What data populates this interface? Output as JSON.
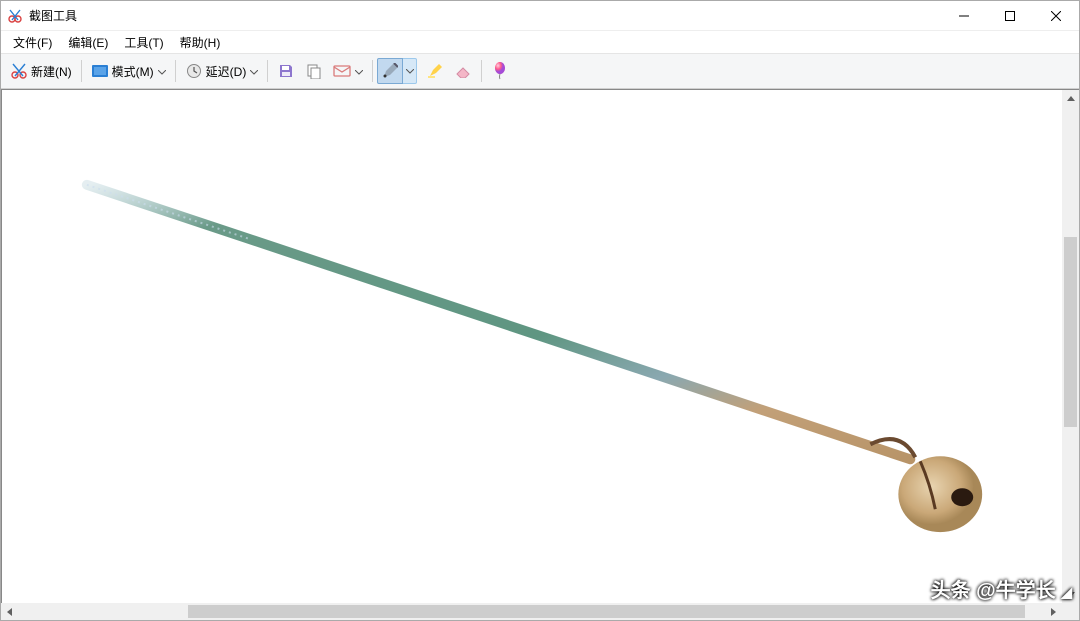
{
  "titlebar": {
    "title": "截图工具"
  },
  "menu": {
    "file": "文件(F)",
    "edit": "编辑(E)",
    "tools": "工具(T)",
    "help": "帮助(H)"
  },
  "toolbar": {
    "new_label": "新建(N)",
    "mode_label": "模式(M)",
    "delay_label": "延迟(D)"
  },
  "watermark": {
    "prefix": "头条",
    "handle": "@牛学长"
  }
}
